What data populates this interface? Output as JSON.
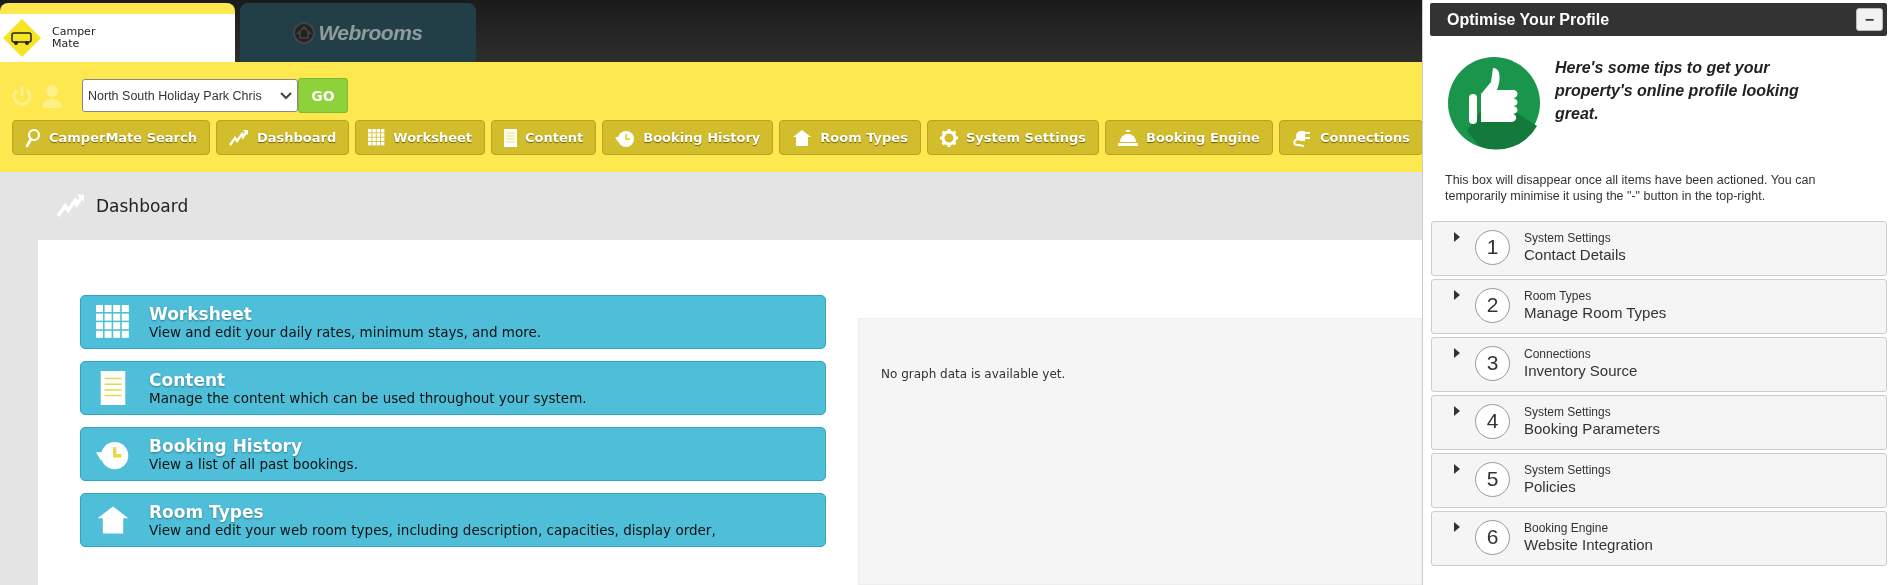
{
  "app_tabs": [
    {
      "label": "Camper Mate",
      "kind": "campermate",
      "selected": true
    },
    {
      "label": "Webrooms",
      "kind": "webrooms",
      "selected": false
    }
  ],
  "property_select": {
    "value": "North South Holiday Park Chris"
  },
  "go_button": "GO",
  "nav": [
    {
      "label": "CamperMate Search"
    },
    {
      "label": "Dashboard"
    },
    {
      "label": "Worksheet"
    },
    {
      "label": "Content"
    },
    {
      "label": "Booking History"
    },
    {
      "label": "Room Types"
    },
    {
      "label": "System Settings"
    },
    {
      "label": "Booking Engine"
    },
    {
      "label": "Connections"
    }
  ],
  "page_title": "Dashboard",
  "cards": [
    {
      "title": "Worksheet",
      "description": "View and edit your daily rates, minimum stays, and more."
    },
    {
      "title": "Content",
      "description": "Manage the content which can be used throughout your system."
    },
    {
      "title": "Booking History",
      "description": "View a list of all past bookings."
    },
    {
      "title": "Room Types",
      "description": "View and edit your web room types, including description, capacities, display order,"
    }
  ],
  "graph_message": "No graph data is available yet.",
  "profile": {
    "title": "Optimise Your Profile",
    "minimise_button": "−",
    "tip": "Here's some tips to get your property's online profile looking great.",
    "note": "This box will disappear once all items have been actioned. You can temporarily minimise it using the \"-\" button in the top-right.",
    "items": [
      {
        "number": "1",
        "category": "System Settings",
        "title": "Contact Details",
        "expanded": false
      },
      {
        "number": "2",
        "category": "Room Types",
        "title": "Manage Room Types",
        "expanded": false
      },
      {
        "number": "3",
        "category": "Connections",
        "title": "Inventory Source",
        "expanded": false
      },
      {
        "number": "4",
        "category": "System Settings",
        "title": "Booking Parameters",
        "expanded": false
      },
      {
        "number": "5",
        "category": "System Settings",
        "title": "Policies",
        "expanded": false
      },
      {
        "number": "6",
        "category": "Booking Engine",
        "title": "Website Integration",
        "expanded": false
      }
    ]
  }
}
